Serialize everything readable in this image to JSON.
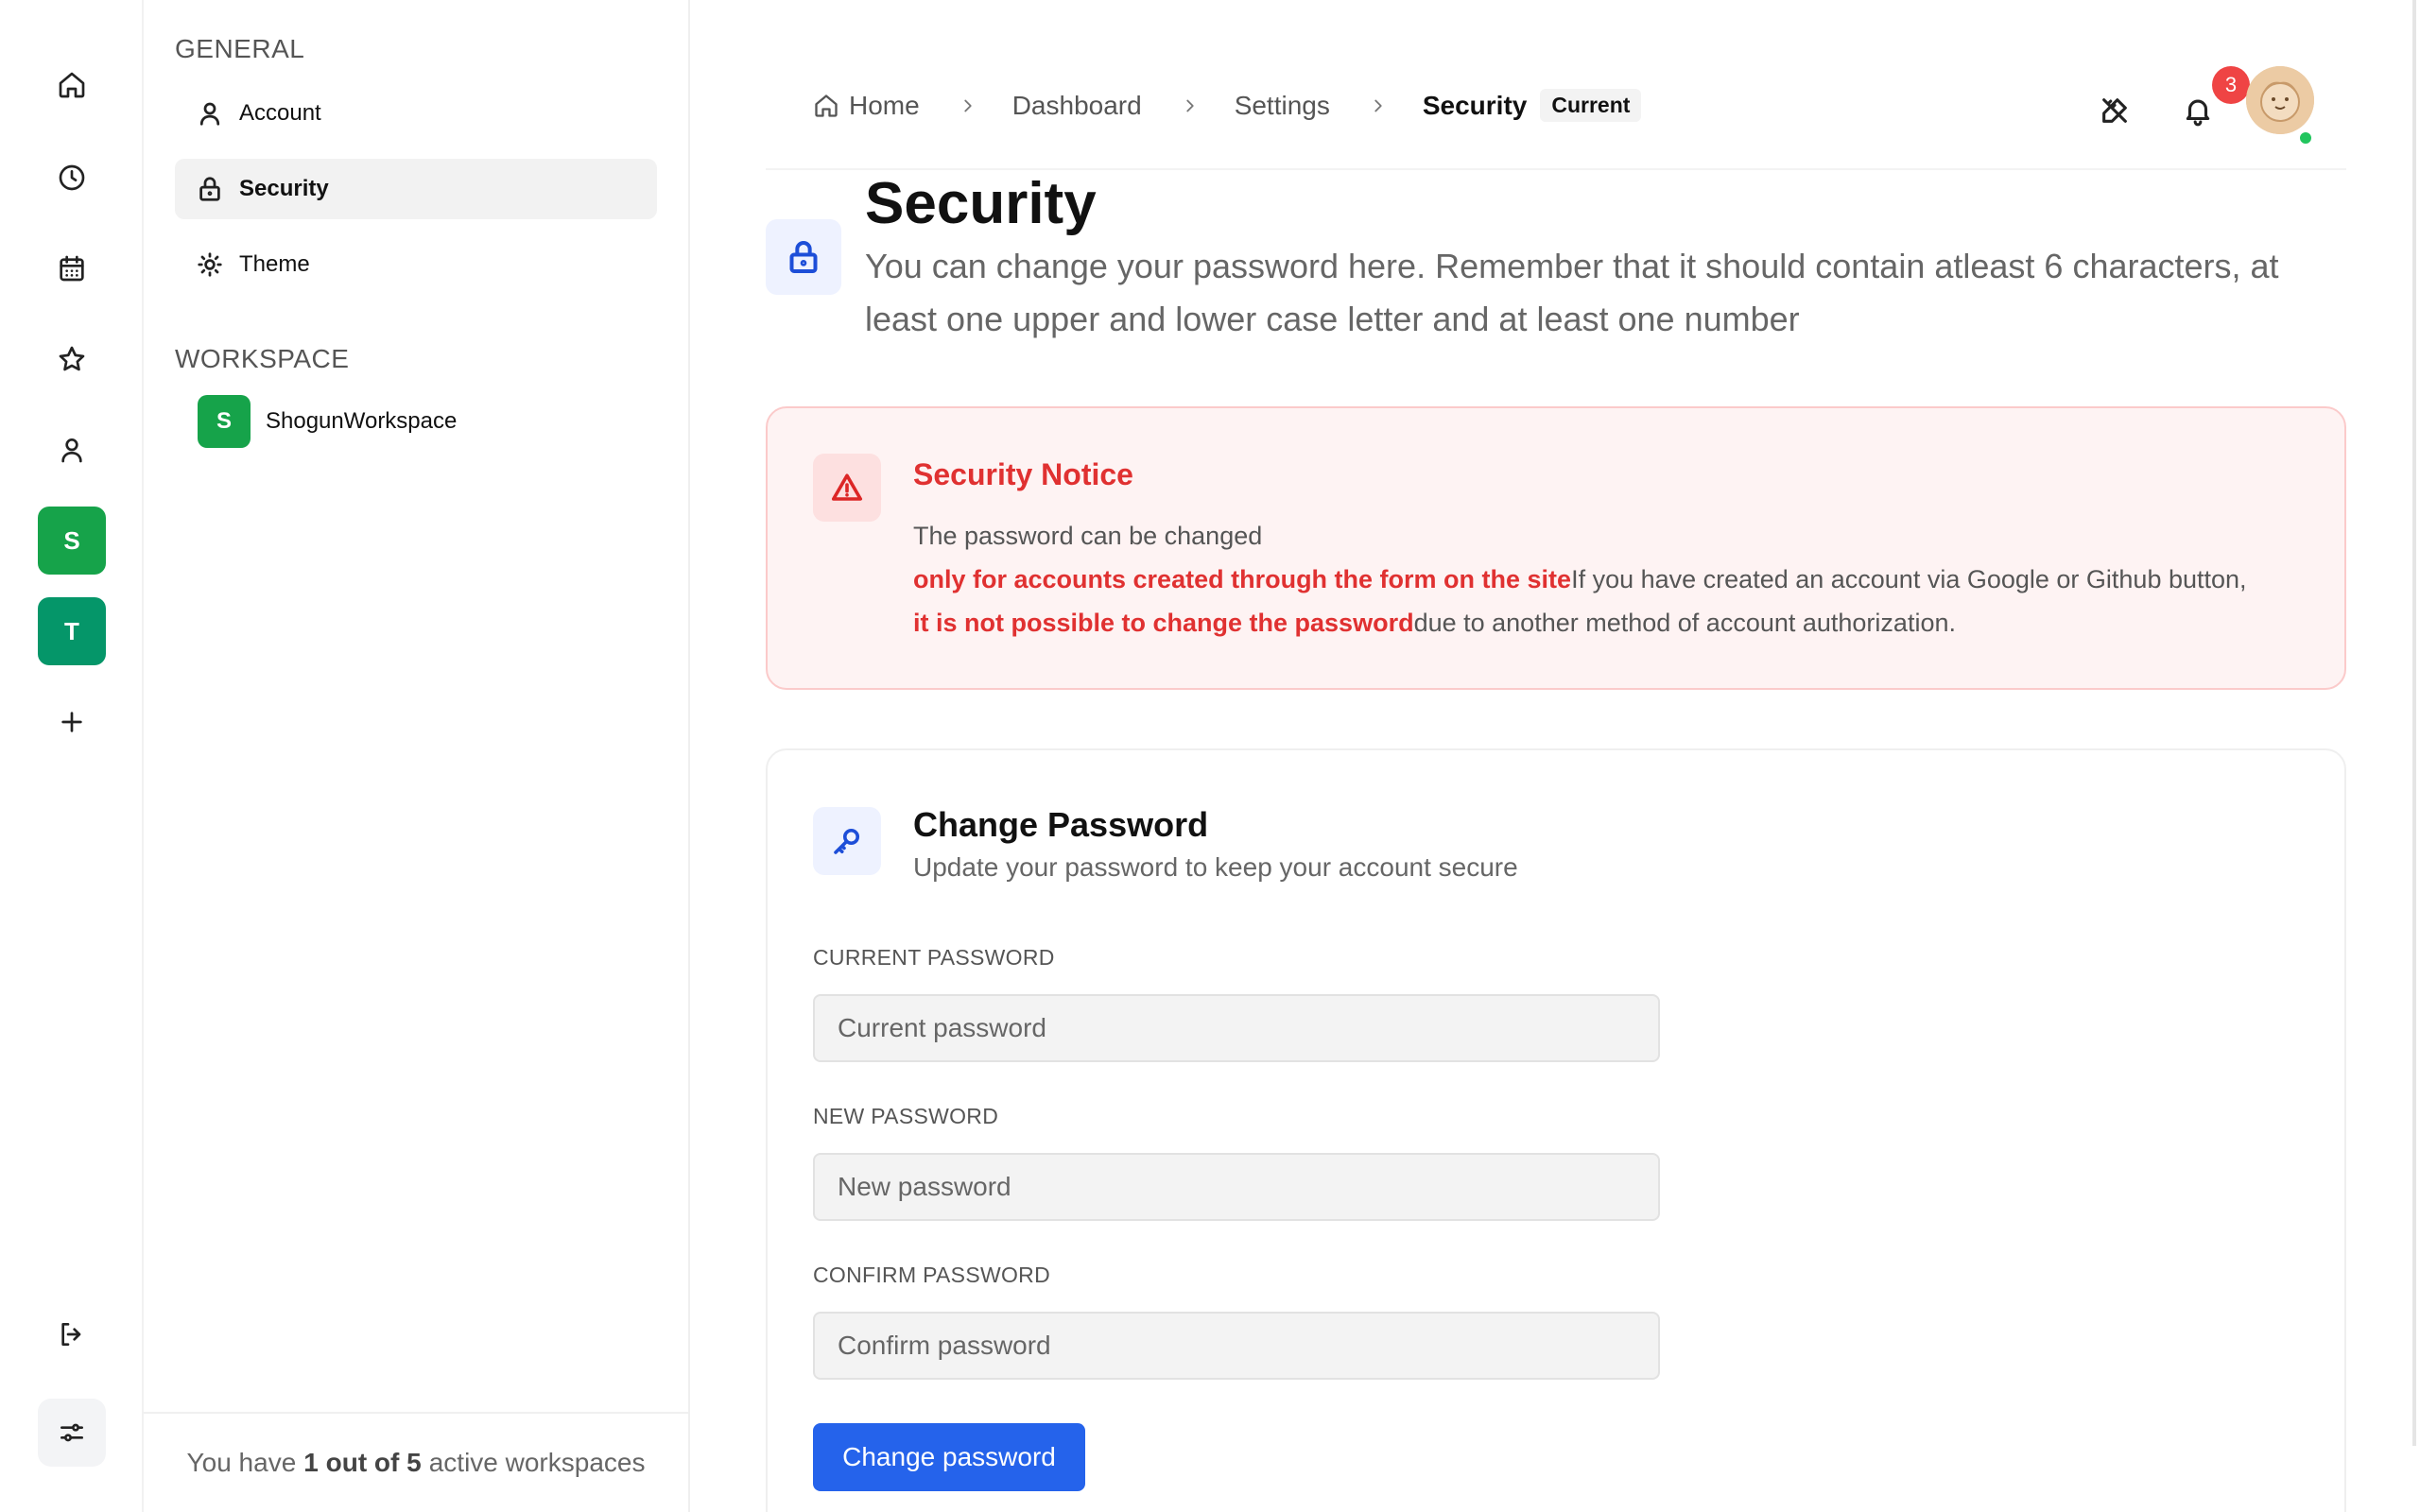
{
  "colors": {
    "accent": "#2563eb",
    "workspace_s": "#16a34a",
    "workspace_t": "#059669",
    "danger": "#e03131",
    "online": "#22c55e"
  },
  "rail": {
    "workspaces": [
      {
        "letter": "S"
      },
      {
        "letter": "T"
      }
    ]
  },
  "sidebar": {
    "general_heading": "GENERAL",
    "items": [
      {
        "label": "Account",
        "icon": "user-icon"
      },
      {
        "label": "Security",
        "icon": "lock-icon",
        "active": true
      },
      {
        "label": "Theme",
        "icon": "sun-icon"
      }
    ],
    "workspace_heading": "WORKSPACE",
    "workspace": {
      "letter": "S",
      "name": "ShogunWorkspace"
    },
    "footer": {
      "prefix": "You have",
      "count": "1 out of 5",
      "suffix": "active workspaces"
    }
  },
  "header": {
    "breadcrumb": {
      "home": "Home",
      "dashboard": "Dashboard",
      "settings": "Settings",
      "current": "Security",
      "current_tag": "Current"
    },
    "notification_count": "3"
  },
  "page": {
    "title": "Security",
    "description": "You can change your password here. Remember that it should contain atleast 6 characters, at least one upper and lower case letter and at least one number"
  },
  "notice": {
    "title": "Security Notice",
    "line1": "The password can be changed",
    "highlight1": "only for accounts created through the form on the site",
    "line2": "If you have created an account via Google or Github button,",
    "highlight2": "it is not possible to change the password",
    "line3": "due to another method of account authorization."
  },
  "change_password": {
    "title": "Change Password",
    "subtitle": "Update your password to keep your account secure",
    "current_label": "CURRENT PASSWORD",
    "current_placeholder": "Current password",
    "new_label": "NEW PASSWORD",
    "new_placeholder": "New password",
    "confirm_label": "CONFIRM PASSWORD",
    "confirm_placeholder": "Confirm password",
    "submit_label": "Change password"
  }
}
